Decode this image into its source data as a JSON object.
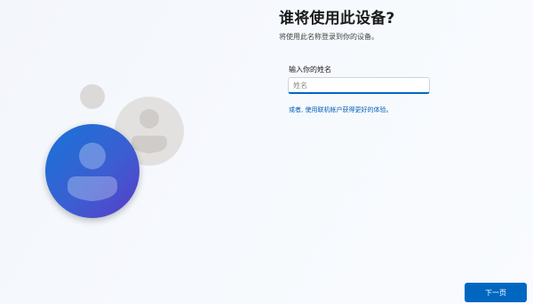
{
  "header": {
    "title": "谁将使用此设备?",
    "subtitle": "将使用此名称登录到你的设备。"
  },
  "form": {
    "name_label": "输入你的姓名",
    "name_placeholder": "姓名",
    "name_value": ""
  },
  "links": {
    "microsoft_account": "或者, 使用联机帐户获得更好的体验。"
  },
  "footer": {
    "next_label": "下一页"
  },
  "illustration": {
    "primary_avatar_icon": "person-icon",
    "secondary_avatar_icon": "person-icon"
  },
  "colors": {
    "accent": "#0067c0",
    "link": "#005fb8",
    "avatar_blue_start": "#1c74d6",
    "avatar_purple_end": "#5b3fc9",
    "avatar_gray": "#e2e0de"
  }
}
